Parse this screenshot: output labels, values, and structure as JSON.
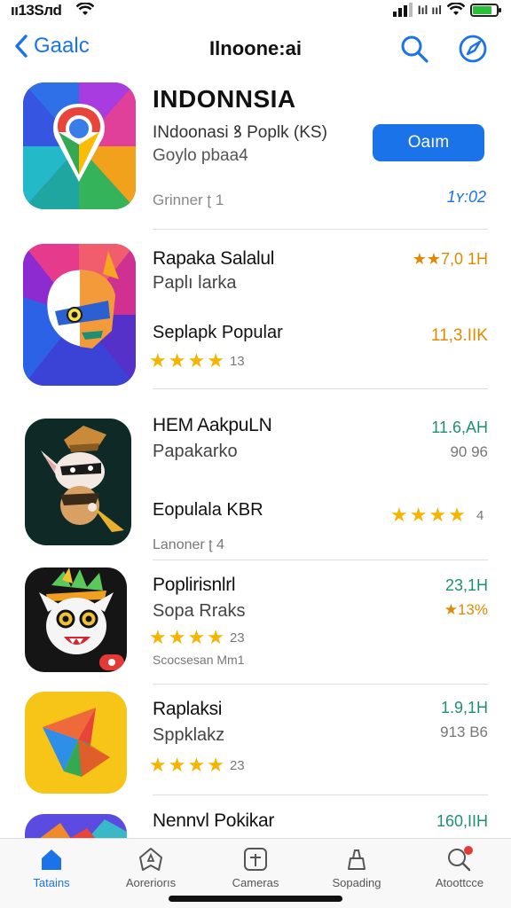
{
  "status_bar": {
    "time": "ıı13Sлd",
    "carrier": "Iıl ııl"
  },
  "nav": {
    "back_label": "Gaalc",
    "title": "Ilnoone:ai"
  },
  "featured": {
    "title": "INDONNSIA",
    "subtitle": "INdoonasi ꝸ Poplk (KS)",
    "developer": "Goylo pbaa4",
    "note": "Grinner ʈ 1",
    "button_label": "Oaım",
    "size": "1ʏ:02"
  },
  "apps": [
    {
      "name": "Rapaka Salalul",
      "sub": "Paplı larka",
      "line3": "Seplapk Popular",
      "right_top": "★★7,0 1H",
      "right_bottom": "11,3.IIK",
      "rating": 4,
      "rating_count": "13"
    },
    {
      "name": "HEM AakpuLN",
      "sub": "Papakarko",
      "line3": "Eopulala KBR",
      "right_top": "11.6,AH",
      "right_bottom": "90 96",
      "rating": 4,
      "rating_count": "4",
      "note": "Lanoner ʈ 4"
    },
    {
      "name": "Poplirisnlrl",
      "sub": "Sopa Rraks",
      "right_top": "23,1H",
      "right_bottom": "★13%",
      "rating": 4,
      "rating_count": "23",
      "note": "Scocsesan Mm1"
    },
    {
      "name": "Raplaksi",
      "sub": "Sppklakz",
      "right_top": "1.9,1H",
      "right_bottom": "913 B6",
      "rating": 4,
      "rating_count": "23"
    },
    {
      "name": "Nennvl Pokikar",
      "right_top": "160,IIH"
    }
  ],
  "tabs": [
    {
      "label": "Tatains",
      "icon": "home-icon"
    },
    {
      "label": "Aoreriorıs",
      "icon": "star-shield-icon"
    },
    {
      "label": "Cameras",
      "icon": "add-box-icon"
    },
    {
      "label": "Sopading",
      "icon": "bag-icon"
    },
    {
      "label": "Atoottcce",
      "icon": "search-notify-icon"
    }
  ],
  "colors": {
    "accent": "#1a73e8",
    "star": "#f4b400",
    "green": "#1f8f73",
    "orange": "#e08a00",
    "badge": "#e53935"
  }
}
